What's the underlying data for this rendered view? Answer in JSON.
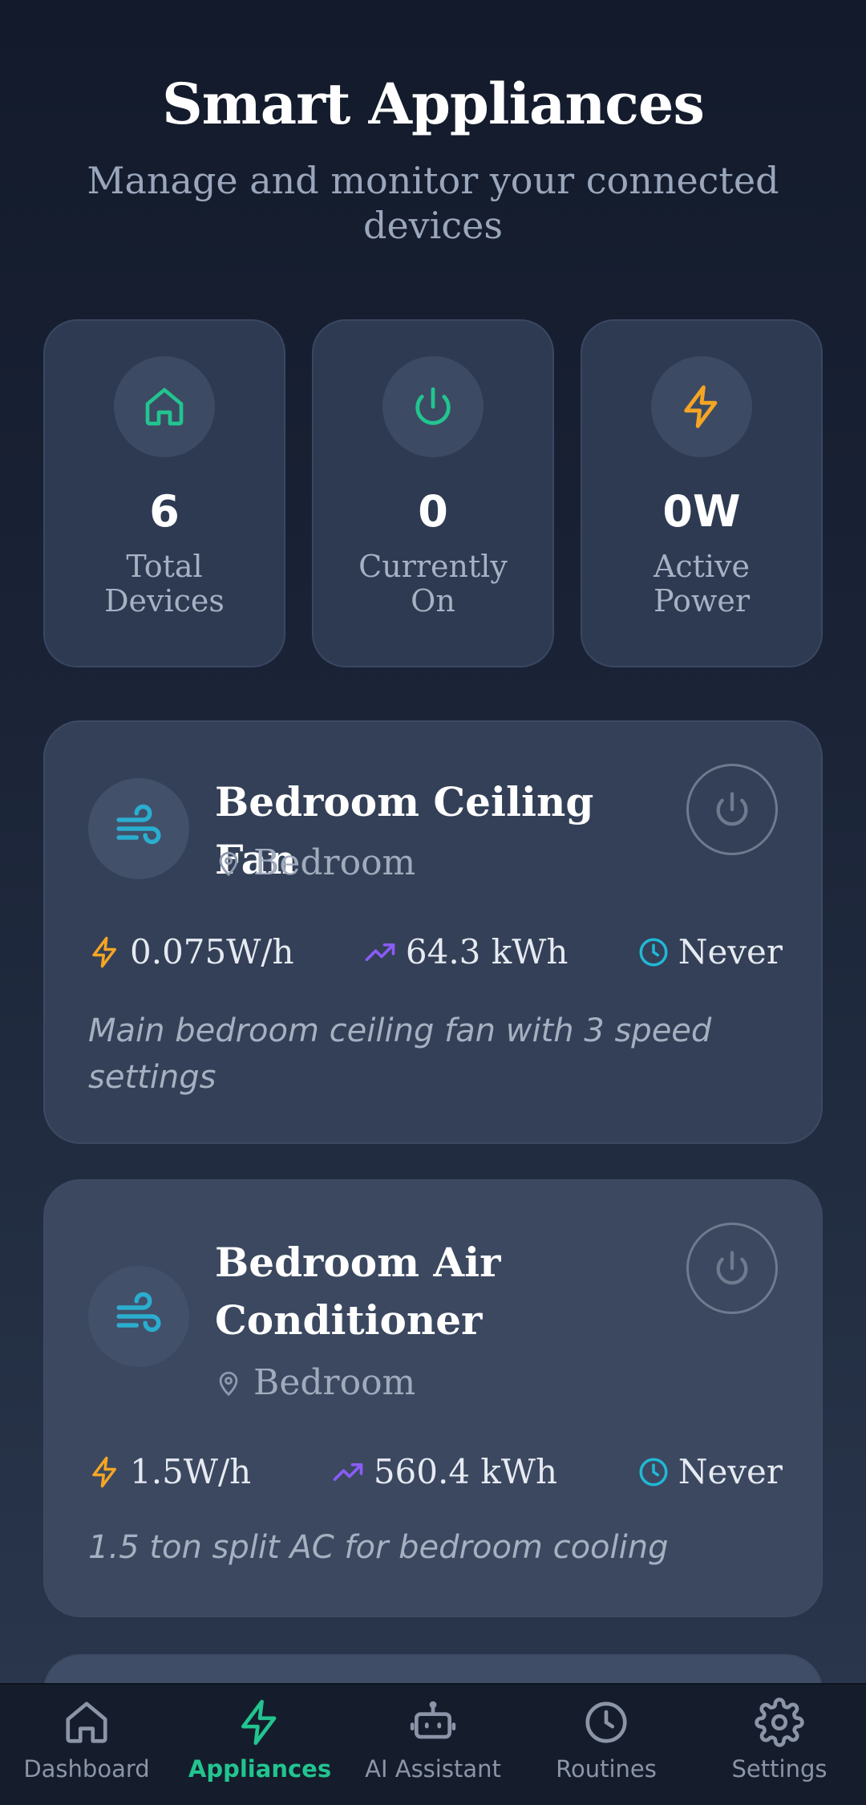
{
  "header": {
    "title": "Smart Appliances",
    "subtitle": "Manage and monitor your connected devices"
  },
  "stats": [
    {
      "value": "6",
      "label": "Total Devices",
      "icon": "home-icon",
      "color": "#22c48f"
    },
    {
      "value": "0",
      "label": "Currently On",
      "icon": "power-icon",
      "color": "#22c48f"
    },
    {
      "value": "0W",
      "label": "Active Power",
      "icon": "lightning-icon",
      "color": "#f5a524"
    }
  ],
  "devices": [
    {
      "name": "Bedroom Ceiling Fan",
      "location": "Bedroom",
      "power": "0.075W/h",
      "energy": "64.3 kWh",
      "last_used": "Never",
      "description": "Main bedroom ceiling fan with 3 speed settings",
      "icon": "wind-icon"
    },
    {
      "name": "Bedroom Air Conditioner",
      "location": "Bedroom",
      "power": "1.5W/h",
      "energy": "560.4 kWh",
      "last_used": "Never",
      "description": "1.5 ton split AC for bedroom cooling",
      "icon": "wind-icon"
    }
  ],
  "nav": {
    "items": [
      {
        "label": "Dashboard",
        "icon": "home-icon"
      },
      {
        "label": "Appliances",
        "icon": "lightning-icon",
        "active": true
      },
      {
        "label": "AI Assistant",
        "icon": "robot-icon"
      },
      {
        "label": "Routines",
        "icon": "clock-icon"
      },
      {
        "label": "Settings",
        "icon": "gear-icon"
      }
    ]
  },
  "colors": {
    "accent": "#22c48f",
    "power": "#f5a524",
    "energy": "#8b5cf6",
    "time": "#22b8d6",
    "device_icon": "#2aaed0"
  }
}
